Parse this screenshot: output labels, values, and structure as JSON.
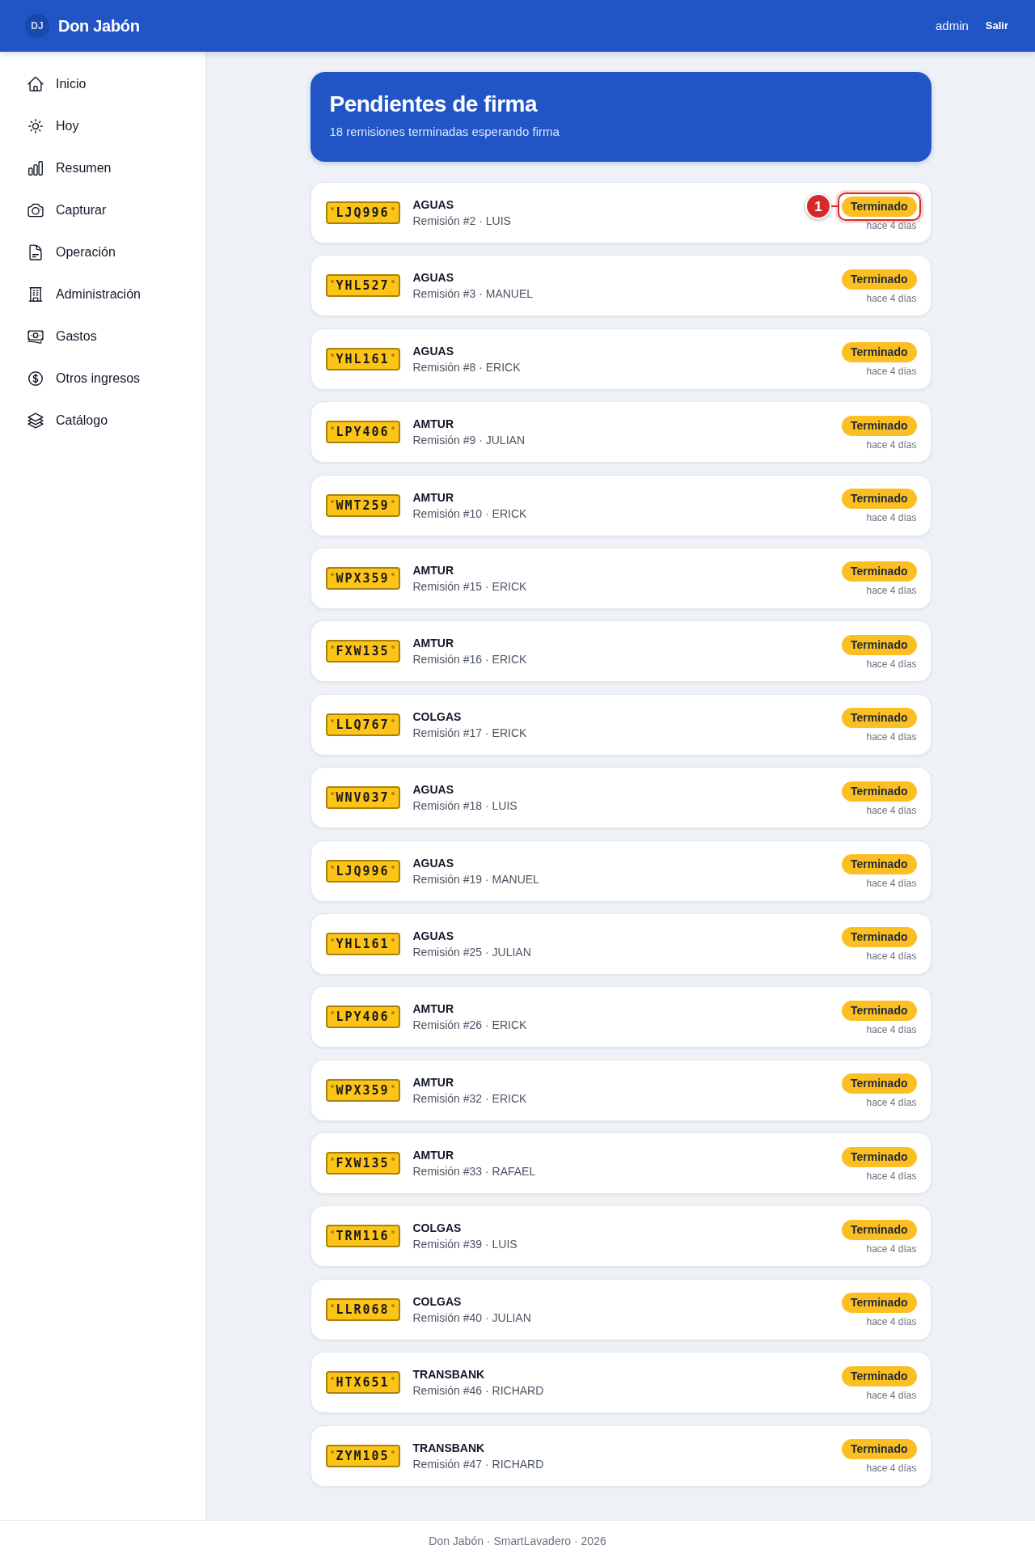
{
  "header": {
    "logo": "DJ",
    "brand": "Don Jabón",
    "user": "admin",
    "logout": "Salir"
  },
  "sidebar": {
    "items": [
      {
        "label": "Inicio",
        "selected": false
      },
      {
        "label": "Hoy",
        "selected": false
      },
      {
        "label": "Resumen",
        "selected": false
      },
      {
        "label": "Capturar",
        "selected": false
      },
      {
        "label": "Operación",
        "selected": false
      },
      {
        "label": "Administración",
        "selected": false
      },
      {
        "label": "Gastos",
        "selected": false
      },
      {
        "label": "Otros ingresos",
        "selected": false
      },
      {
        "label": "Catálogo",
        "selected": false
      }
    ]
  },
  "page": {
    "title": "Pendientes de firma",
    "subtitle": "18 remisiones terminadas esperando firma"
  },
  "rows": [
    {
      "plate": "LJQ996",
      "client": "AGUAS",
      "detail": "Remisión #2 · LUIS",
      "status": "Terminado",
      "time": "hace 4 días",
      "callout": "1"
    },
    {
      "plate": "YHL527",
      "client": "AGUAS",
      "detail": "Remisión #3 · MANUEL",
      "status": "Terminado",
      "time": "hace 4 días"
    },
    {
      "plate": "YHL161",
      "client": "AGUAS",
      "detail": "Remisión #8 · ERICK",
      "status": "Terminado",
      "time": "hace 4 días"
    },
    {
      "plate": "LPY406",
      "client": "AMTUR",
      "detail": "Remisión #9 · JULIAN",
      "status": "Terminado",
      "time": "hace 4 días"
    },
    {
      "plate": "WMT259",
      "client": "AMTUR",
      "detail": "Remisión #10 · ERICK",
      "status": "Terminado",
      "time": "hace 4 días"
    },
    {
      "plate": "WPX359",
      "client": "AMTUR",
      "detail": "Remisión #15 · ERICK",
      "status": "Terminado",
      "time": "hace 4 días"
    },
    {
      "plate": "FXW135",
      "client": "AMTUR",
      "detail": "Remisión #16 · ERICK",
      "status": "Terminado",
      "time": "hace 4 días"
    },
    {
      "plate": "LLQ767",
      "client": "COLGAS",
      "detail": "Remisión #17 · ERICK",
      "status": "Terminado",
      "time": "hace 4 días"
    },
    {
      "plate": "WNV037",
      "client": "AGUAS",
      "detail": "Remisión #18 · LUIS",
      "status": "Terminado",
      "time": "hace 4 días"
    },
    {
      "plate": "LJQ996",
      "client": "AGUAS",
      "detail": "Remisión #19 · MANUEL",
      "status": "Terminado",
      "time": "hace 4 días"
    },
    {
      "plate": "YHL161",
      "client": "AGUAS",
      "detail": "Remisión #25 · JULIAN",
      "status": "Terminado",
      "time": "hace 4 días"
    },
    {
      "plate": "LPY406",
      "client": "AMTUR",
      "detail": "Remisión #26 · ERICK",
      "status": "Terminado",
      "time": "hace 4 días"
    },
    {
      "plate": "WPX359",
      "client": "AMTUR",
      "detail": "Remisión #32 · ERICK",
      "status": "Terminado",
      "time": "hace 4 días"
    },
    {
      "plate": "FXW135",
      "client": "AMTUR",
      "detail": "Remisión #33 · RAFAEL",
      "status": "Terminado",
      "time": "hace 4 días"
    },
    {
      "plate": "TRM116",
      "client": "COLGAS",
      "detail": "Remisión #39 · LUIS",
      "status": "Terminado",
      "time": "hace 4 días"
    },
    {
      "plate": "LLR068",
      "client": "COLGAS",
      "detail": "Remisión #40 · JULIAN",
      "status": "Terminado",
      "time": "hace 4 días"
    },
    {
      "plate": "HTX651",
      "client": "TRANSBANK",
      "detail": "Remisión #46 · RICHARD",
      "status": "Terminado",
      "time": "hace 4 días"
    },
    {
      "plate": "ZYM105",
      "client": "TRANSBANK",
      "detail": "Remisión #47 · RICHARD",
      "status": "Terminado",
      "time": "hace 4 días"
    }
  ],
  "footer": "Don Jabón · SmartLavadero · 2026"
}
